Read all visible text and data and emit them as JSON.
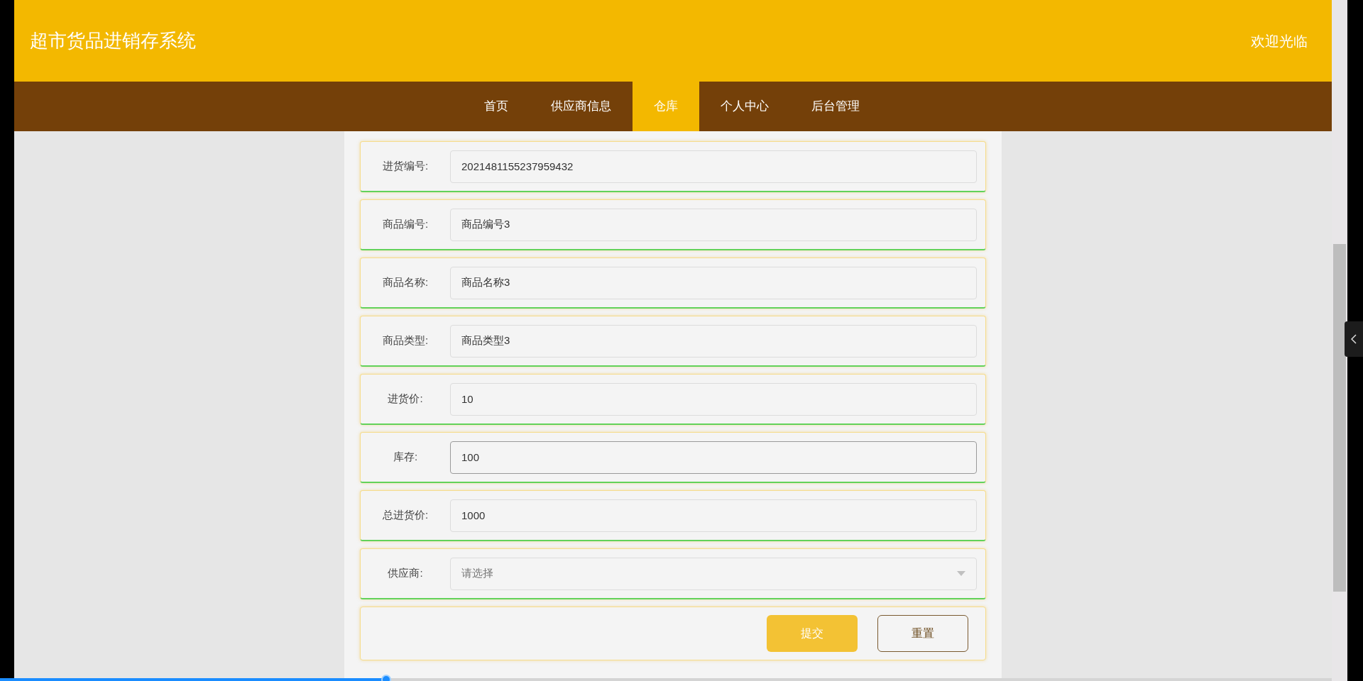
{
  "header": {
    "title": "超市货品进销存系统",
    "welcome": "欢迎光临"
  },
  "nav": [
    {
      "label": "首页",
      "selected": false
    },
    {
      "label": "供应商信息",
      "selected": false
    },
    {
      "label": "仓库",
      "selected": true
    },
    {
      "label": "个人中心",
      "selected": false
    },
    {
      "label": "后台管理",
      "selected": false
    }
  ],
  "form": {
    "fields": [
      {
        "kind": "text",
        "label": "进货编号:",
        "value": "2021481155237959432",
        "focused": false
      },
      {
        "kind": "text",
        "label": "商品编号:",
        "value": "商品编号3",
        "focused": false
      },
      {
        "kind": "text",
        "label": "商品名称:",
        "value": "商品名称3",
        "focused": false
      },
      {
        "kind": "text",
        "label": "商品类型:",
        "value": "商品类型3",
        "focused": false
      },
      {
        "kind": "text",
        "label": "进货价:",
        "value": "10",
        "focused": false
      },
      {
        "kind": "text",
        "label": "库存:",
        "value": "100",
        "focused": true
      },
      {
        "kind": "text",
        "label": "总进货价:",
        "value": "1000",
        "focused": false
      },
      {
        "kind": "select",
        "label": "供应商:",
        "placeholder": "请选择",
        "focused": false
      }
    ],
    "buttons": [
      {
        "kind": "primary",
        "label": "提交"
      },
      {
        "kind": "secondary",
        "label": "重置"
      }
    ]
  },
  "video_progress": {
    "level": 0.29
  }
}
